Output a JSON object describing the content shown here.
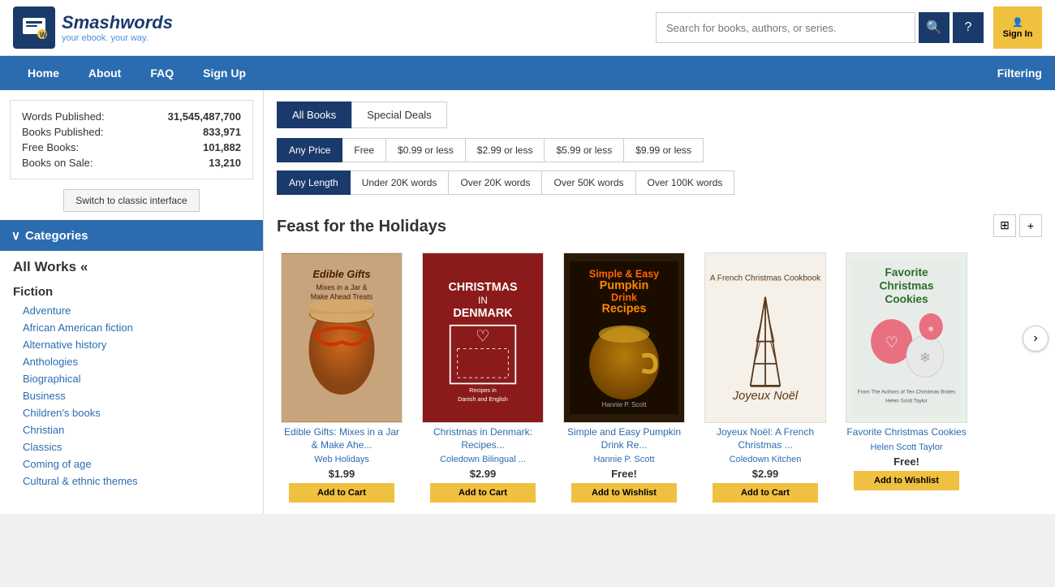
{
  "logo": {
    "name": "Smashwords",
    "tagline": "your ebook. your way.",
    "trademark": "™"
  },
  "search": {
    "placeholder": "Search for books, authors, or series."
  },
  "signin": {
    "label": "Sign In"
  },
  "nav": {
    "links": [
      "Home",
      "About",
      "FAQ",
      "Sign Up"
    ],
    "filter": "Filtering"
  },
  "stats": {
    "words_published_label": "Words Published:",
    "words_published_value": "31,545,487,700",
    "books_published_label": "Books Published:",
    "books_published_value": "833,971",
    "free_books_label": "Free Books:",
    "free_books_value": "101,882",
    "books_on_sale_label": "Books on Sale:",
    "books_on_sale_value": "13,210"
  },
  "switch_btn": "Switch to classic interface",
  "categories": {
    "header": "Categories",
    "all_works": "All Works «",
    "fiction_heading": "Fiction",
    "fiction_items": [
      "Adventure",
      "African American fiction",
      "Alternative history",
      "Anthologies",
      "Biographical",
      "Business",
      "Children's books",
      "Christian",
      "Classics",
      "Coming of age",
      "Cultural & ethnic themes"
    ]
  },
  "tabs": {
    "all_books": "All Books",
    "special_deals": "Special Deals"
  },
  "price_filters": {
    "any_price": "Any Price",
    "free": "Free",
    "0_99": "$0.99 or less",
    "2_99": "$2.99 or less",
    "5_99": "$5.99 or less",
    "9_99": "$9.99 or less"
  },
  "length_filters": {
    "any_length": "Any Length",
    "under_20k": "Under 20K words",
    "over_20k": "Over 20K words",
    "over_50k": "Over 50K words",
    "over_100k": "Over 100K words"
  },
  "section_title": "Feast for the Holidays",
  "books": [
    {
      "title": "Edible Gifts: Mixes in a Jar & Make Ahe...",
      "author": "Web Holidays",
      "price": "$1.99",
      "btn_label": "Add to Cart",
      "cover_type": "edible"
    },
    {
      "title": "Christmas in Denmark: Recipes...",
      "author": "Coledown Bilingual ...",
      "price": "$2.99",
      "btn_label": "Add to Cart",
      "cover_type": "christmas_dk"
    },
    {
      "title": "Simple and Easy Pumpkin Drink Re...",
      "author": "Hannie P. Scott",
      "price": "Free!",
      "btn_label": "Add to Wishlist",
      "cover_type": "pumpkin"
    },
    {
      "title": "Joyeux Noël: A French Christmas ...",
      "author": "Coledown Kitchen",
      "price": "$2.99",
      "btn_label": "Add to Cart",
      "cover_type": "noel"
    },
    {
      "title": "Favorite Christmas Cookies",
      "author": "Helen Scott Taylor",
      "price": "Free!",
      "btn_label": "Add to Wishlist",
      "cover_type": "cookies"
    }
  ]
}
